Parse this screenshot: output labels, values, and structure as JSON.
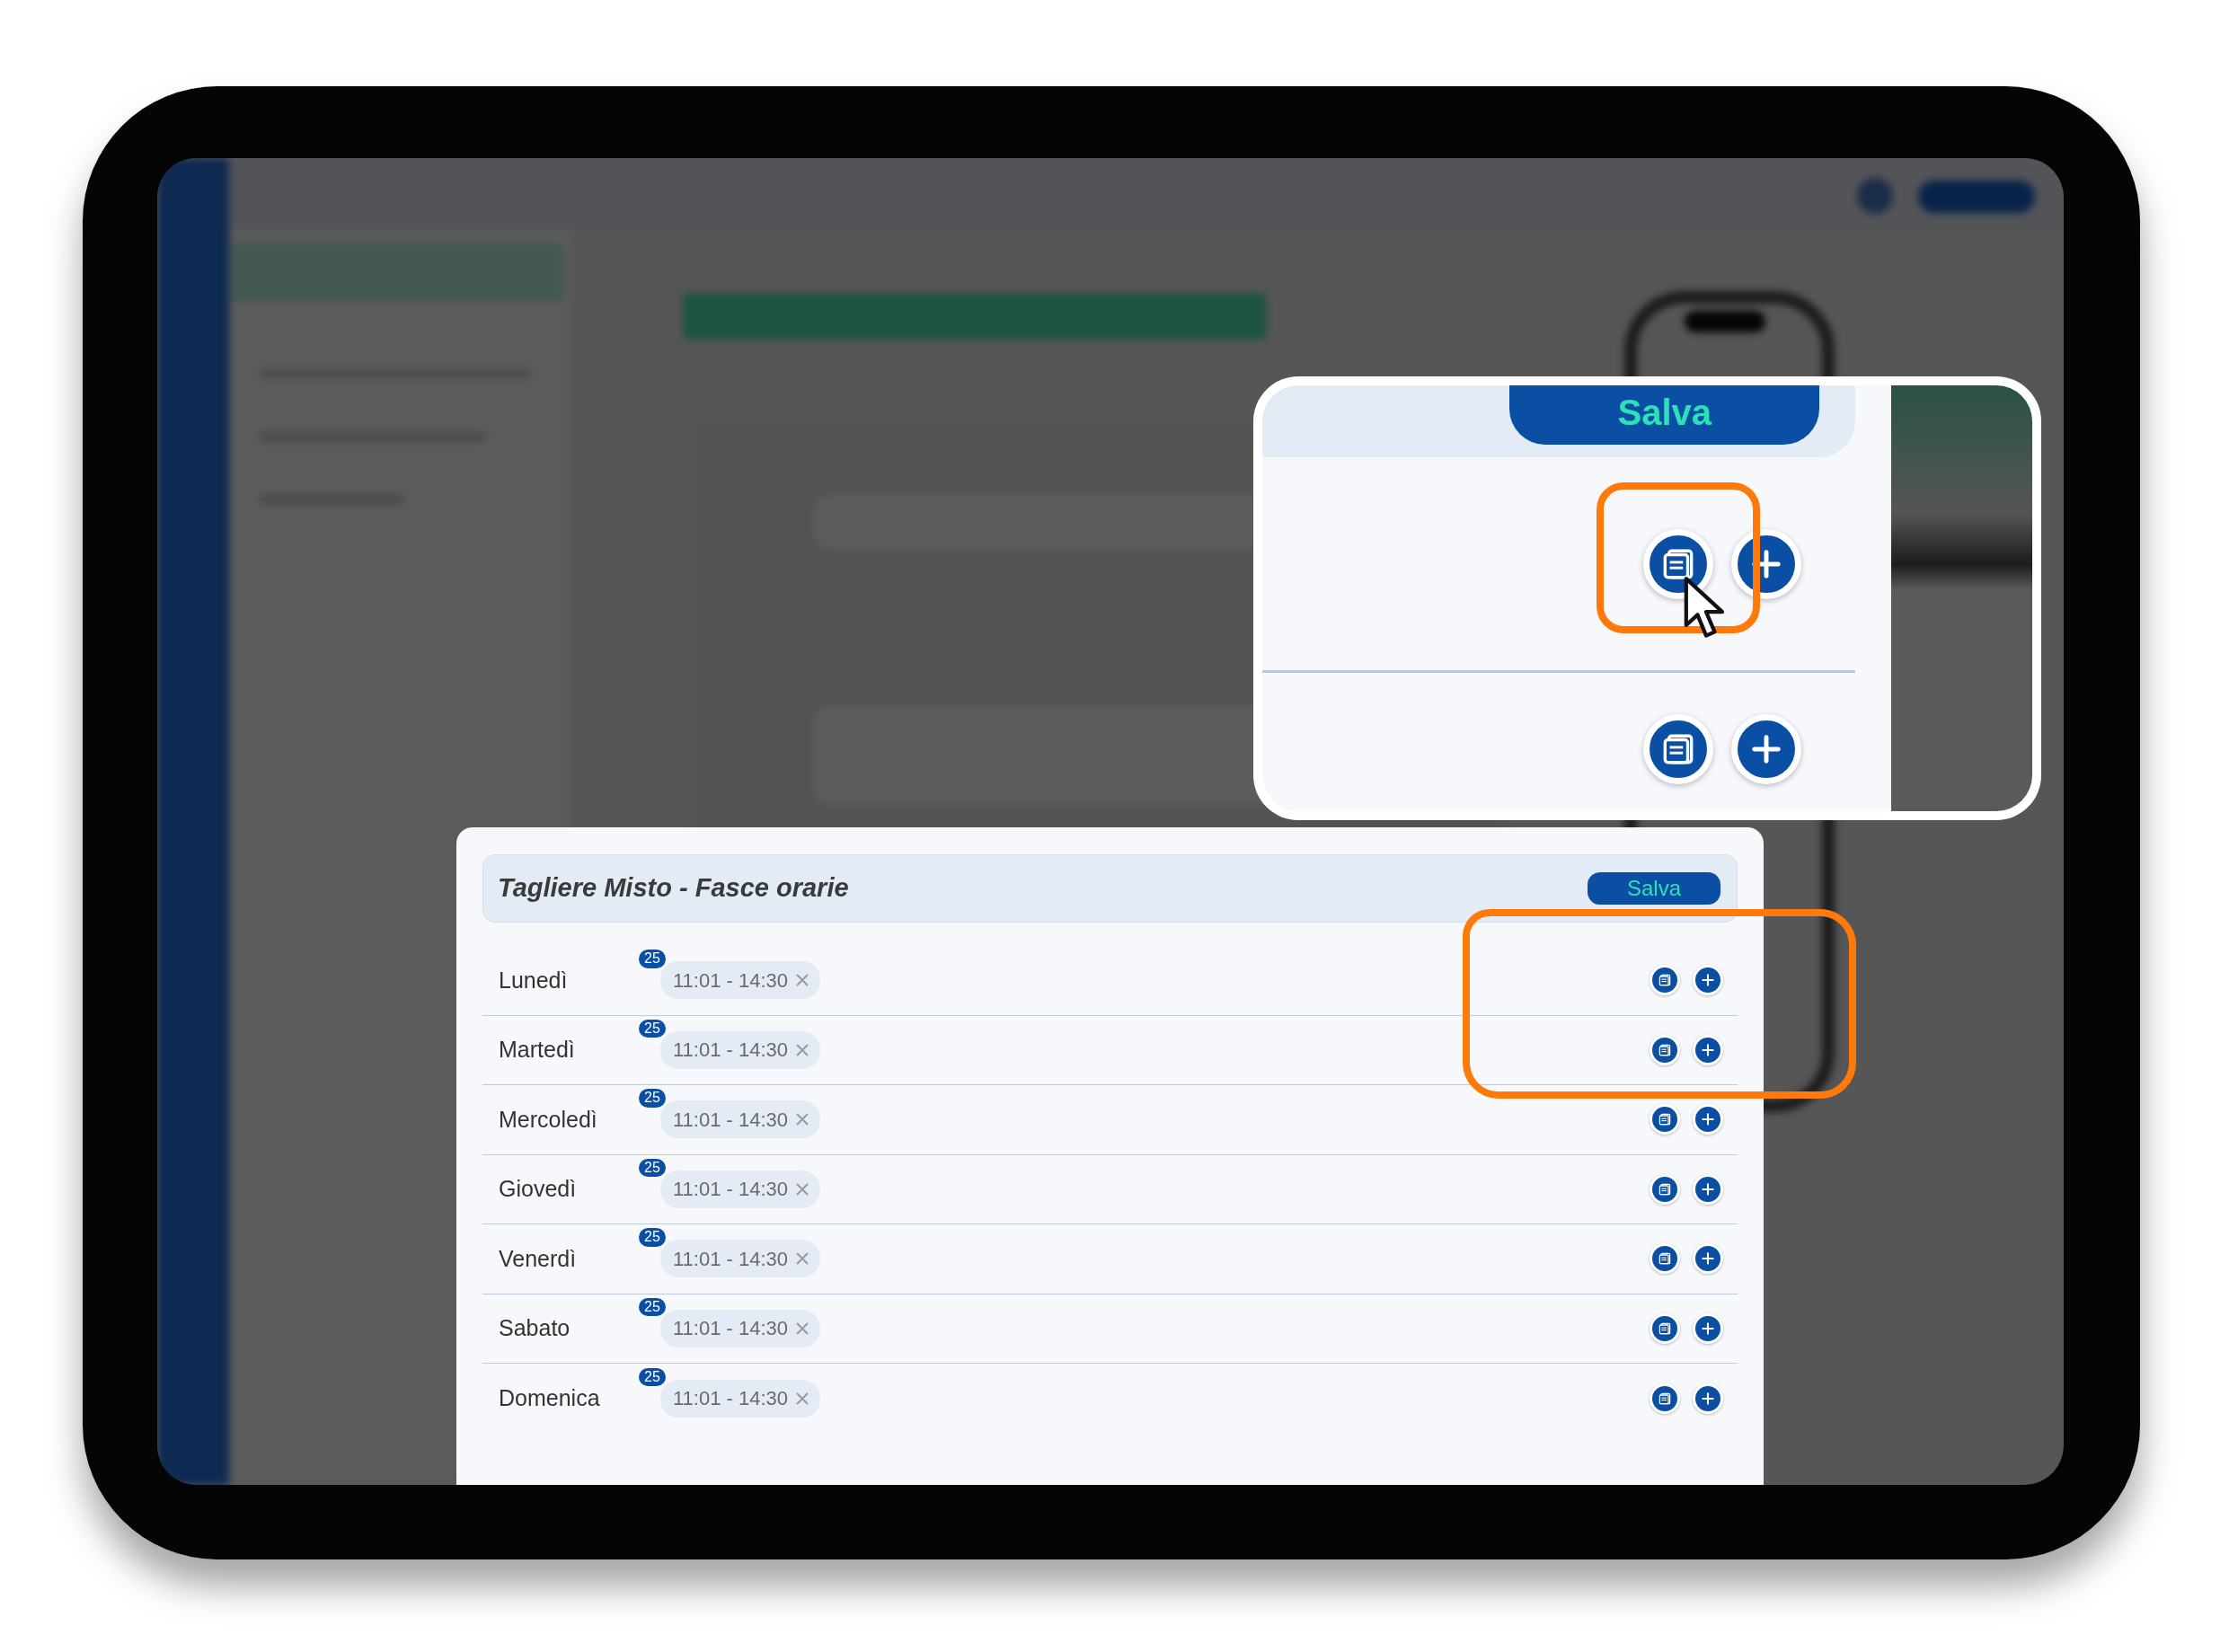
{
  "modal": {
    "title": "Tagliere Misto - Fasce orarie",
    "save_label": "Salva",
    "days": [
      {
        "name": "Lunedì",
        "slots": [
          {
            "count": "25",
            "time": "11:01 - 14:30"
          }
        ]
      },
      {
        "name": "Martedì",
        "slots": [
          {
            "count": "25",
            "time": "11:01 - 14:30"
          }
        ]
      },
      {
        "name": "Mercoledì",
        "slots": [
          {
            "count": "25",
            "time": "11:01 - 14:30"
          }
        ]
      },
      {
        "name": "Giovedì",
        "slots": [
          {
            "count": "25",
            "time": "11:01 - 14:30"
          }
        ]
      },
      {
        "name": "Venerdì",
        "slots": [
          {
            "count": "25",
            "time": "11:01 - 14:30"
          }
        ]
      },
      {
        "name": "Sabato",
        "slots": [
          {
            "count": "25",
            "time": "11:01 - 14:30"
          }
        ]
      },
      {
        "name": "Domenica",
        "slots": [
          {
            "count": "25",
            "time": "11:01 - 14:30"
          }
        ]
      }
    ]
  },
  "zoom_inset": {
    "save_label": "Salva",
    "rows": [
      {
        "hovered": true
      },
      {
        "hovered": false
      }
    ]
  }
}
